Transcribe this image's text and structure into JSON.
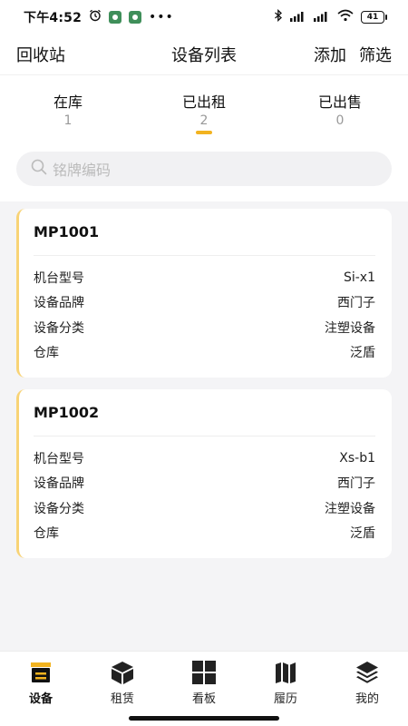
{
  "status_bar": {
    "time": "下午4:52",
    "dots": "•••",
    "battery": "41"
  },
  "header": {
    "recycle_label": "回收站",
    "title": "设备列表",
    "add_label": "添加",
    "filter_label": "筛选"
  },
  "tabs": [
    {
      "label": "在库",
      "count": "1"
    },
    {
      "label": "已出租",
      "count": "2"
    },
    {
      "label": "已出售",
      "count": "0"
    }
  ],
  "active_tab": 1,
  "search": {
    "placeholder": "铭牌编码"
  },
  "cards": [
    {
      "code": "MP1001",
      "rows": [
        {
          "label": "机台型号",
          "value": "Si-x1"
        },
        {
          "label": "设备品牌",
          "value": "西门子"
        },
        {
          "label": "设备分类",
          "value": "注塑设备"
        },
        {
          "label": "仓库",
          "value": "泛盾"
        }
      ]
    },
    {
      "code": "MP1002",
      "rows": [
        {
          "label": "机台型号",
          "value": "Xs-b1"
        },
        {
          "label": "设备品牌",
          "value": "西门子"
        },
        {
          "label": "设备分类",
          "value": "注塑设备"
        },
        {
          "label": "仓库",
          "value": "泛盾"
        }
      ]
    }
  ],
  "bottom_nav": [
    {
      "label": "设备",
      "icon": "device-icon"
    },
    {
      "label": "租赁",
      "icon": "box-icon"
    },
    {
      "label": "看板",
      "icon": "dashboard-icon"
    },
    {
      "label": "履历",
      "icon": "map-icon"
    },
    {
      "label": "我的",
      "icon": "layers-icon"
    }
  ],
  "colors": {
    "accent": "#f2b320",
    "card_border": "#f8d376",
    "list_background": "#f4f4f6"
  }
}
